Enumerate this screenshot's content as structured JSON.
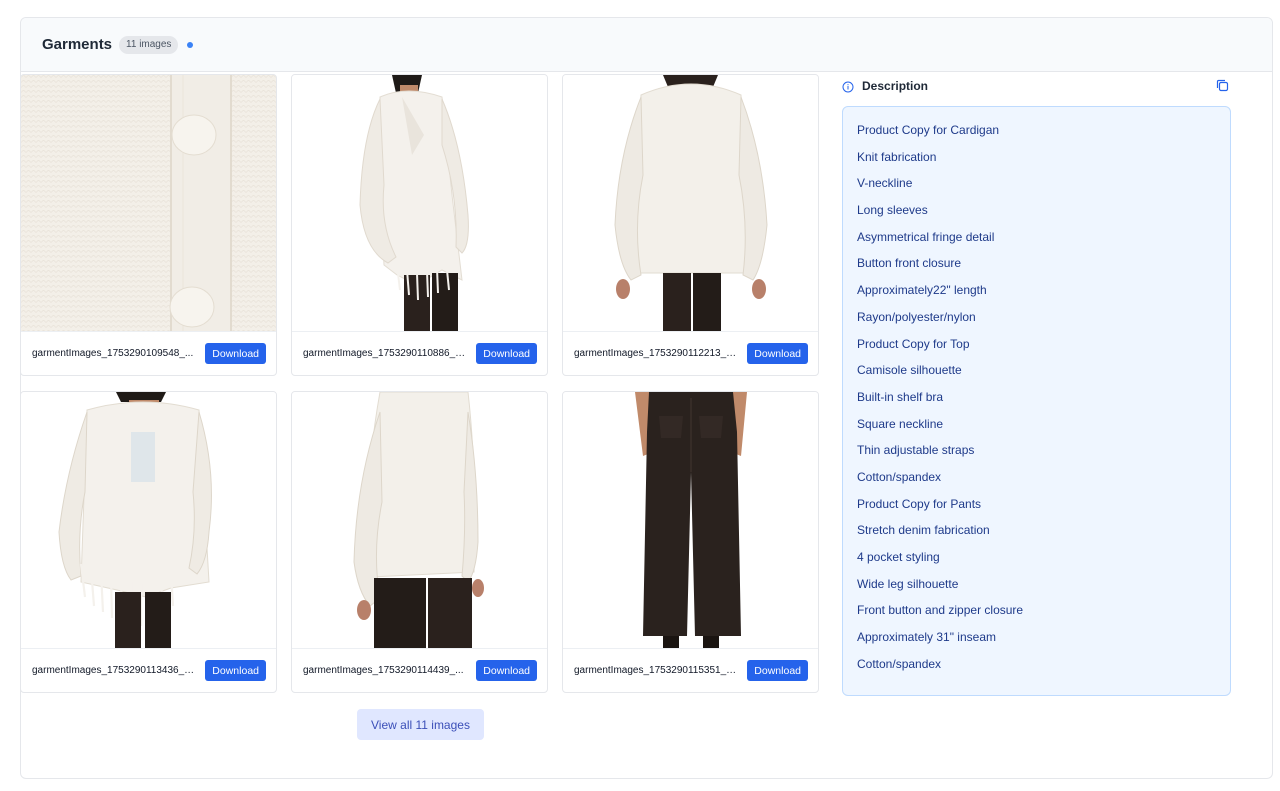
{
  "header": {
    "title": "Garments",
    "count_badge": "11 images",
    "status_color": "#3b82f6"
  },
  "images": [
    {
      "filename": "garmentImages_1753290109548_...",
      "download_label": "Download",
      "content": "cardigan-knit-closeup"
    },
    {
      "filename": "garmentImages_1753290110886_s...",
      "download_label": "Download",
      "content": "cardigan-side-view"
    },
    {
      "filename": "garmentImages_1753290112213_s...",
      "download_label": "Download",
      "content": "cardigan-back-view"
    },
    {
      "filename": "garmentImages_1753290113436_s...",
      "download_label": "Download",
      "content": "cardigan-front-view"
    },
    {
      "filename": "garmentImages_1753290114439_...",
      "download_label": "Download",
      "content": "cardigan-rear-side-view"
    },
    {
      "filename": "garmentImages_1753290115351_s...",
      "download_label": "Download",
      "content": "pants-back-view"
    }
  ],
  "view_all_label": "View all 11 images",
  "description": {
    "title": "Description",
    "items": [
      "Product Copy for Cardigan",
      "Knit fabrication",
      "V-neckline",
      "Long sleeves",
      "Asymmetrical fringe detail",
      "Button front closure",
      "Approximately22\" length",
      "Rayon/polyester/nylon",
      "Product Copy for Top",
      "Camisole silhouette",
      "Built-in shelf bra",
      "Square neckline",
      "Thin adjustable straps",
      "Cotton/spandex",
      "Product Copy for Pants",
      "Stretch denim fabrication",
      "4 pocket styling",
      "Wide leg silhouette",
      "Front button and zipper closure",
      "Approximately 31\" inseam",
      "Cotton/spandex"
    ]
  },
  "icons": {
    "info": "info-icon",
    "copy": "copy-icon"
  },
  "colors": {
    "accent": "#2563eb",
    "description_bg": "#eff6ff",
    "description_text": "#1e3a8a"
  }
}
